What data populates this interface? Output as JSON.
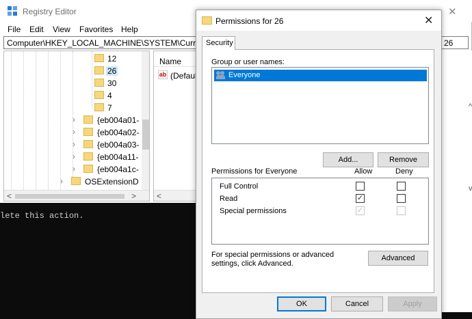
{
  "console": {
    "text": "lete this action."
  },
  "regedit": {
    "title": "Registry Editor",
    "close_glyph": "✕",
    "menu": [
      "File",
      "Edit",
      "View",
      "Favorites",
      "Help"
    ],
    "address": "Computer\\HKEY_LOCAL_MACHINE\\SYSTEM\\Curren",
    "address_tail": "26",
    "tree": [
      {
        "label": "12",
        "selected": false
      },
      {
        "label": "26",
        "selected": true
      },
      {
        "label": "30",
        "selected": false
      },
      {
        "label": "4",
        "selected": false
      },
      {
        "label": "7",
        "selected": false
      },
      {
        "label": "{eb004a01-",
        "selected": false
      },
      {
        "label": "{eb004a02-",
        "selected": false
      },
      {
        "label": "{eb004a03-",
        "selected": false
      },
      {
        "label": "{eb004a11-",
        "selected": false
      },
      {
        "label": "{eb004a1c-",
        "selected": false
      },
      {
        "label": "OSExtensionD",
        "selected": false
      }
    ],
    "list_header": "Name",
    "list_icon": "ab",
    "list_value": "(Defaul",
    "scroll_left": "<",
    "scroll_right": ">",
    "scroll_up": "^",
    "scroll_down": "v"
  },
  "dialog": {
    "title": "Permissions for 26",
    "close_glyph": "✕",
    "tab_security": "Security",
    "group_label": "Group or user names:",
    "users": [
      "Everyone"
    ],
    "add_button": "Add...",
    "remove_button": "Remove",
    "permissions_label": "Permissions for Everyone",
    "allow_label": "Allow",
    "deny_label": "Deny",
    "permissions": [
      {
        "name": "Full Control",
        "allow": false,
        "deny": false,
        "disabled": false
      },
      {
        "name": "Read",
        "allow": true,
        "deny": false,
        "disabled": false
      },
      {
        "name": "Special permissions",
        "allow": true,
        "deny": false,
        "disabled": true
      }
    ],
    "advanced_text": "For special permissions or advanced settings, click Advanced.",
    "advanced_button": "Advanced",
    "ok_button": "OK",
    "cancel_button": "Cancel",
    "apply_button": "Apply"
  },
  "colors": {
    "selection": "#0078d7",
    "tree_selection": "#cce8ff",
    "folder": "#f7d77d",
    "console_bg": "#0c0c0c"
  }
}
